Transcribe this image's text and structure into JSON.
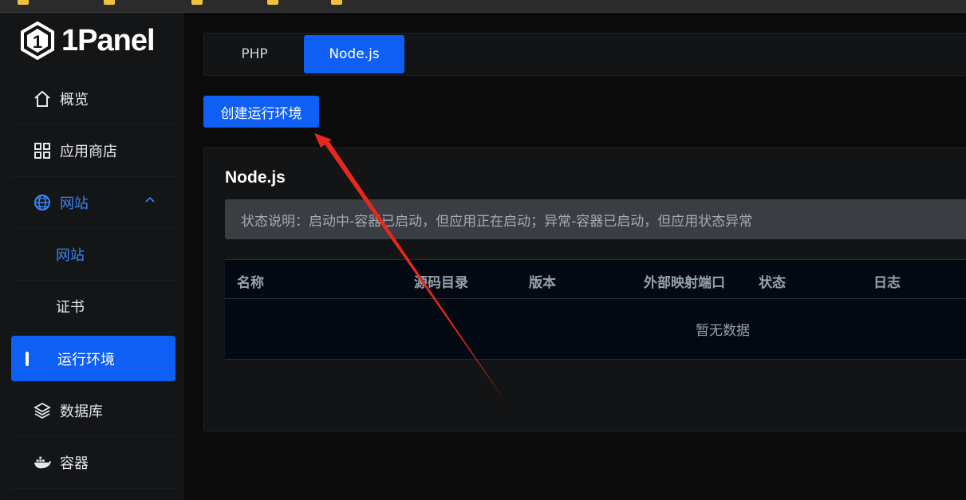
{
  "app": {
    "logo_text": "1Panel"
  },
  "sidebar": {
    "items": [
      {
        "label": "概览",
        "icon": "home-icon"
      },
      {
        "label": "应用商店",
        "icon": "grid-icon"
      },
      {
        "label": "网站",
        "icon": "globe-icon",
        "expanded": true
      },
      {
        "label": "网站",
        "sub": true
      },
      {
        "label": "证书",
        "sub": true
      },
      {
        "label": "运行环境",
        "sub": true,
        "active": true
      },
      {
        "label": "数据库",
        "icon": "layers-icon"
      },
      {
        "label": "容器",
        "icon": "docker-icon"
      }
    ]
  },
  "tabs": [
    {
      "label": "PHP",
      "active": false
    },
    {
      "label": "Node.js",
      "active": true
    }
  ],
  "toolbar": {
    "create_label": "创建运行环境"
  },
  "card": {
    "title": "Node.js",
    "notice": "状态说明：启动中-容器已启动，但应用正在启动；异常-容器已启动，但应用状态异常"
  },
  "table": {
    "headers": [
      "名称",
      "源码目录",
      "版本",
      "外部映射端口",
      "状态",
      "日志"
    ],
    "empty_text": "暂无数据"
  },
  "colors": {
    "accent": "#0f5ff5",
    "annotation_arrow": "#e8281e"
  }
}
